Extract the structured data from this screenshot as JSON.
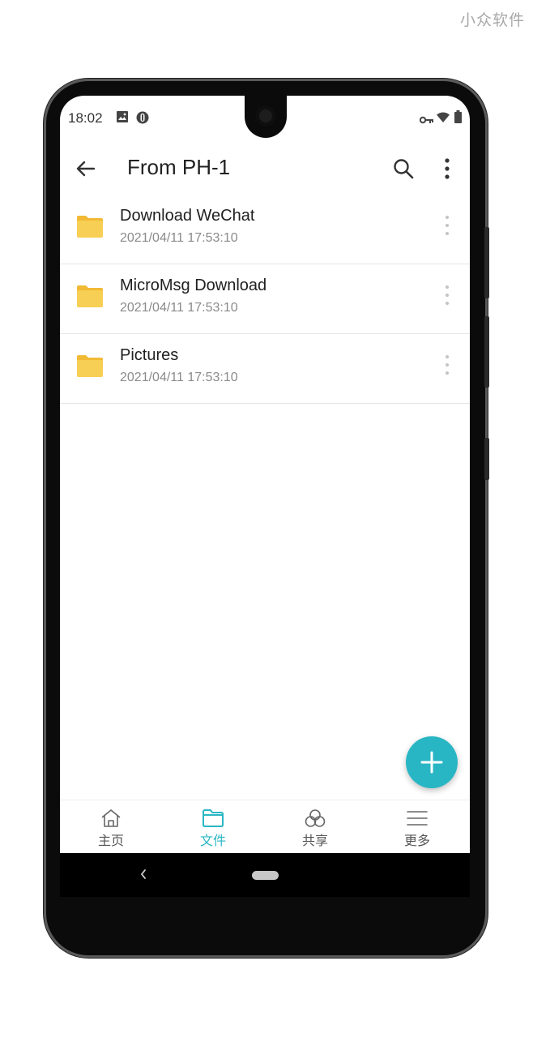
{
  "watermark": "小众软件",
  "status_bar": {
    "time": "18:02",
    "icons": [
      "image-icon",
      "circle-badge-icon",
      "vpn-key-icon",
      "wifi-icon",
      "battery-icon"
    ]
  },
  "app_bar": {
    "title": "From PH-1",
    "back_icon": "arrow-left-icon",
    "search_icon": "search-icon",
    "more_icon": "more-vert-icon"
  },
  "files": [
    {
      "name": "Download WeChat",
      "date": "2021/04/11 17:53:10",
      "icon": "folder-icon"
    },
    {
      "name": "MicroMsg Download",
      "date": "2021/04/11 17:53:10",
      "icon": "folder-icon"
    },
    {
      "name": "Pictures",
      "date": "2021/04/11 17:53:10",
      "icon": "folder-icon"
    }
  ],
  "fab": {
    "icon": "plus-icon"
  },
  "bottom_nav": [
    {
      "label": "主页",
      "icon": "home-icon",
      "active": false
    },
    {
      "label": "文件",
      "icon": "folder-icon",
      "active": true
    },
    {
      "label": "共享",
      "icon": "share-rings-icon",
      "active": false
    },
    {
      "label": "更多",
      "icon": "menu-icon",
      "active": false
    }
  ],
  "colors": {
    "accent": "#29b6c4",
    "folder": "#f6c94d",
    "text_primary": "#202020",
    "text_secondary": "#8a8a8a"
  }
}
